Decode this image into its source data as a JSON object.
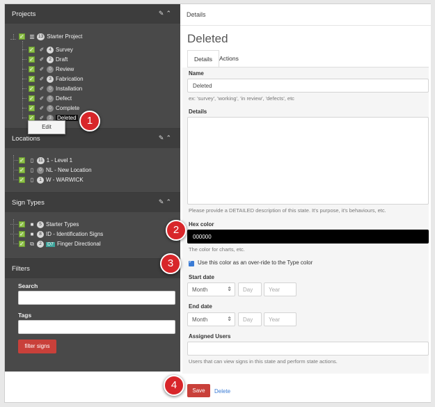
{
  "details_header": "Details",
  "page_title": "Deleted",
  "tabs": [
    {
      "label": "Details",
      "active": true
    },
    {
      "label": "Actions",
      "active": false
    }
  ],
  "projects": {
    "title": "Projects",
    "root": {
      "count": "13",
      "label": "Starter Project"
    },
    "states": [
      {
        "count": "4",
        "label": "Survey"
      },
      {
        "count": "2",
        "label": "Draft"
      },
      {
        "count": "0",
        "label": "Review"
      },
      {
        "count": "3",
        "label": "Fabrication"
      },
      {
        "count": "0",
        "label": "Installation"
      },
      {
        "count": "0",
        "label": "Defect"
      },
      {
        "count": "0",
        "label": "Complete"
      },
      {
        "count": "3",
        "label": "Deleted"
      }
    ],
    "context_menu": "Edit"
  },
  "locations": {
    "title": "Locations",
    "items": [
      {
        "count": "11",
        "label": "1 - Level 1"
      },
      {
        "count": "0",
        "label": "NL - New Location"
      },
      {
        "count": "1",
        "label": "W - WARWICK"
      }
    ]
  },
  "sign_types": {
    "title": "Sign Types",
    "items": [
      {
        "count": "5",
        "label": "Starter Types"
      },
      {
        "count": "8",
        "label": "ID - Identification Signs"
      },
      {
        "count": "2",
        "tag": "D7",
        "label": "Finger Directional"
      }
    ]
  },
  "filters": {
    "title": "Filters",
    "search_label": "Search",
    "tags_label": "Tags",
    "button": "filter signs"
  },
  "form": {
    "name_label": "Name",
    "name_value": "Deleted",
    "name_help": "ex: 'survey', 'working', 'in review', 'defects', etc",
    "details_label": "Details",
    "details_help": "Please provide a DETAILED description of this state. It's purpose, it's behaviours, etc.",
    "hex_label": "Hex color",
    "hex_value": "000000",
    "hex_help": "The color for charts, etc.",
    "override_label": "Use this color as an over-ride to the Type color",
    "override_checked": true,
    "start_label": "Start date",
    "end_label": "End date",
    "month_placeholder": "Month",
    "day_placeholder": "Day",
    "year_placeholder": "Year",
    "users_label": "Assigned Users",
    "users_help": "Users that can view signs in this state and perform state actions.",
    "save": "Save",
    "delete": "Delete"
  },
  "callouts": [
    "1",
    "2",
    "3",
    "4"
  ],
  "colors": {
    "accent_red": "#c9403a",
    "checkbox_green": "#8fc24a",
    "sidebar_dark": "#494949",
    "hex_swatch": "#000000"
  }
}
